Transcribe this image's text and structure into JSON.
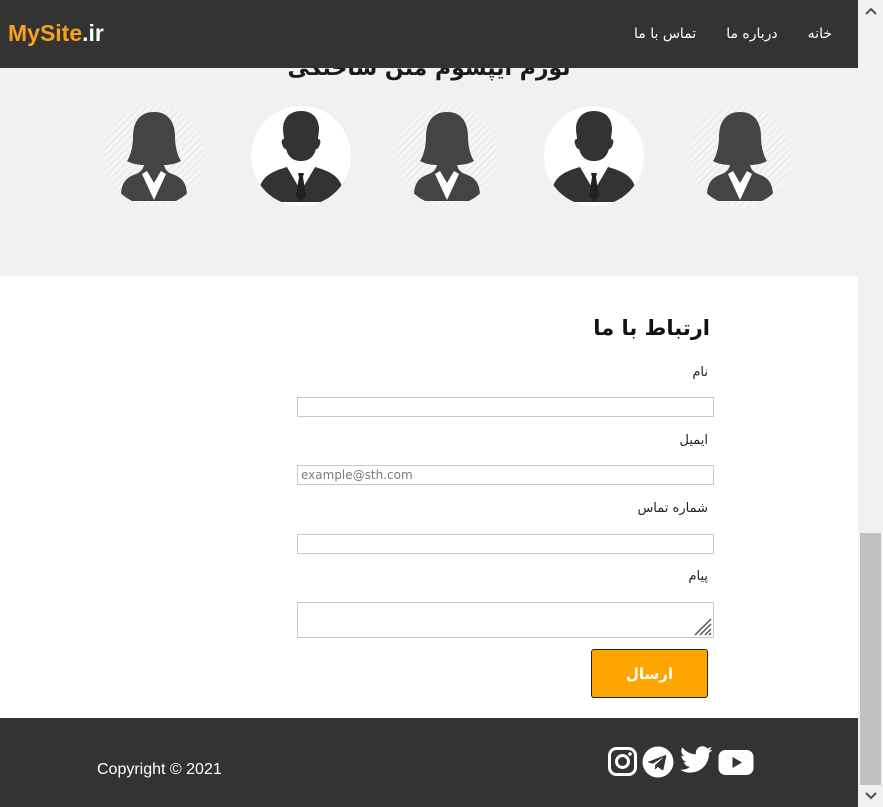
{
  "header": {
    "logo_brand": "MySite",
    "logo_tld": ".ir",
    "nav": [
      "خانه",
      "درباره ما",
      "تماس با ما"
    ]
  },
  "team": {
    "title": "لورم ایپسوم متن ساختگی",
    "members": [
      "female",
      "male",
      "female",
      "male",
      "female"
    ]
  },
  "contact": {
    "title": "ارتباط با ما",
    "name_label": "نام",
    "email_label": "ایمیل",
    "email_placeholder": "example@sth.com",
    "phone_label": "شماره تماس",
    "message_label": "پیام",
    "submit_label": "ارسال"
  },
  "footer": {
    "copyright": "Copyright © 2021",
    "social_icons": [
      "instagram-icon",
      "telegram-icon",
      "twitter-icon",
      "youtube-icon"
    ]
  },
  "colors": {
    "header_bg": "#333333",
    "accent": "#ffa500",
    "logo_brand": "#f7a21a",
    "section_bg": "#f1f1f1"
  }
}
